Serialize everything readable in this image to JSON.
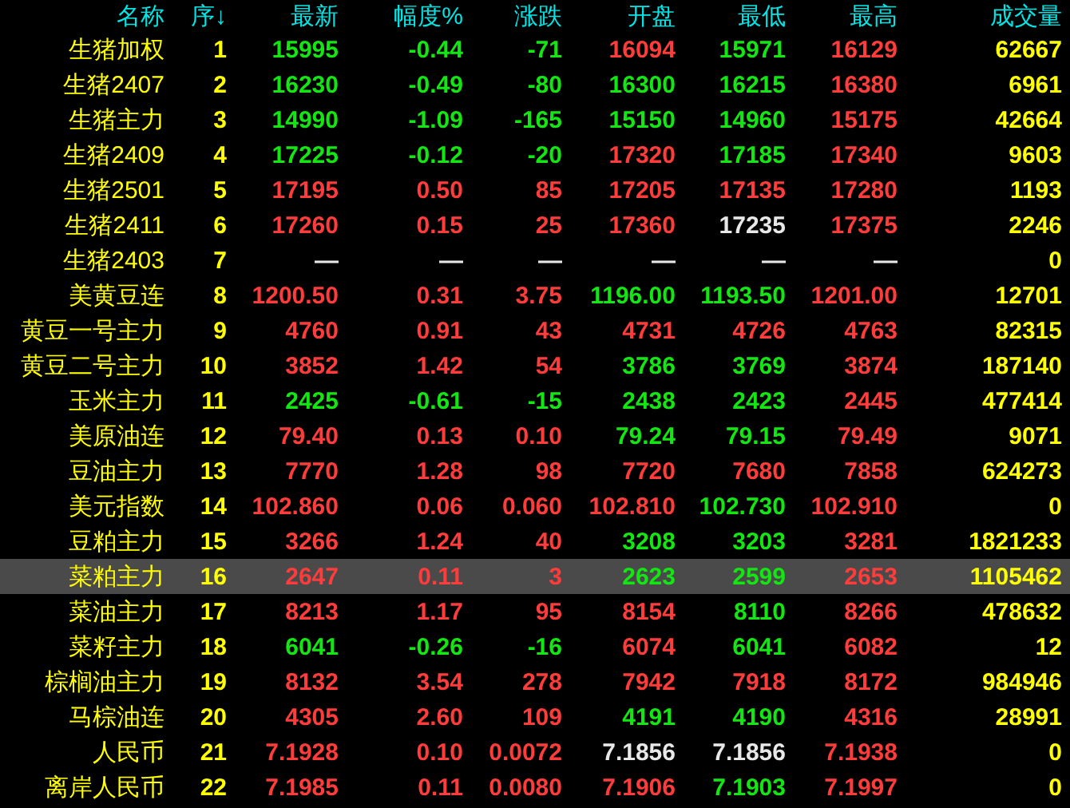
{
  "table": {
    "columns": [
      "名称",
      "序↓",
      "最新",
      "幅度%",
      "涨跌",
      "开盘",
      "最低",
      "最高",
      "成交量"
    ],
    "rows": [
      {
        "selected": false,
        "cells": [
          {
            "text": "生猪加权",
            "color": "#ffff00"
          },
          {
            "text": "1",
            "color": "#ffff00"
          },
          {
            "text": "15995",
            "color": "#14e614"
          },
          {
            "text": "-0.44",
            "color": "#14e614"
          },
          {
            "text": "-71",
            "color": "#14e614"
          },
          {
            "text": "16094",
            "color": "#ff3c3c"
          },
          {
            "text": "15971",
            "color": "#14e614"
          },
          {
            "text": "16129",
            "color": "#ff3c3c"
          },
          {
            "text": "62667",
            "color": "#ffff00"
          }
        ]
      },
      {
        "selected": false,
        "cells": [
          {
            "text": "生猪2407",
            "color": "#ffff00"
          },
          {
            "text": "2",
            "color": "#ffff00"
          },
          {
            "text": "16230",
            "color": "#14e614"
          },
          {
            "text": "-0.49",
            "color": "#14e614"
          },
          {
            "text": "-80",
            "color": "#14e614"
          },
          {
            "text": "16300",
            "color": "#14e614"
          },
          {
            "text": "16215",
            "color": "#14e614"
          },
          {
            "text": "16380",
            "color": "#ff3c3c"
          },
          {
            "text": "6961",
            "color": "#ffff00"
          }
        ]
      },
      {
        "selected": false,
        "cells": [
          {
            "text": "生猪主力",
            "color": "#ffff00"
          },
          {
            "text": "3",
            "color": "#ffff00"
          },
          {
            "text": "14990",
            "color": "#14e614"
          },
          {
            "text": "-1.09",
            "color": "#14e614"
          },
          {
            "text": "-165",
            "color": "#14e614"
          },
          {
            "text": "15150",
            "color": "#14e614"
          },
          {
            "text": "14960",
            "color": "#14e614"
          },
          {
            "text": "15175",
            "color": "#ff3c3c"
          },
          {
            "text": "42664",
            "color": "#ffff00"
          }
        ]
      },
      {
        "selected": false,
        "cells": [
          {
            "text": "生猪2409",
            "color": "#ffff00"
          },
          {
            "text": "4",
            "color": "#ffff00"
          },
          {
            "text": "17225",
            "color": "#14e614"
          },
          {
            "text": "-0.12",
            "color": "#14e614"
          },
          {
            "text": "-20",
            "color": "#14e614"
          },
          {
            "text": "17320",
            "color": "#ff3c3c"
          },
          {
            "text": "17185",
            "color": "#14e614"
          },
          {
            "text": "17340",
            "color": "#ff3c3c"
          },
          {
            "text": "9603",
            "color": "#ffff00"
          }
        ]
      },
      {
        "selected": false,
        "cells": [
          {
            "text": "生猪2501",
            "color": "#ffff00"
          },
          {
            "text": "5",
            "color": "#ffff00"
          },
          {
            "text": "17195",
            "color": "#ff3c3c"
          },
          {
            "text": "0.50",
            "color": "#ff3c3c"
          },
          {
            "text": "85",
            "color": "#ff3c3c"
          },
          {
            "text": "17205",
            "color": "#ff3c3c"
          },
          {
            "text": "17135",
            "color": "#ff3c3c"
          },
          {
            "text": "17280",
            "color": "#ff3c3c"
          },
          {
            "text": "1193",
            "color": "#ffff00"
          }
        ]
      },
      {
        "selected": false,
        "cells": [
          {
            "text": "生猪2411",
            "color": "#ffff00"
          },
          {
            "text": "6",
            "color": "#ffff00"
          },
          {
            "text": "17260",
            "color": "#ff3c3c"
          },
          {
            "text": "0.15",
            "color": "#ff3c3c"
          },
          {
            "text": "25",
            "color": "#ff3c3c"
          },
          {
            "text": "17360",
            "color": "#ff3c3c"
          },
          {
            "text": "17235",
            "color": "#e8e8e8"
          },
          {
            "text": "17375",
            "color": "#ff3c3c"
          },
          {
            "text": "2246",
            "color": "#ffff00"
          }
        ]
      },
      {
        "selected": false,
        "cells": [
          {
            "text": "生猪2403",
            "color": "#ffff00"
          },
          {
            "text": "7",
            "color": "#ffff00"
          },
          {
            "text": "—",
            "color": "#e8e8e8"
          },
          {
            "text": "—",
            "color": "#e8e8e8"
          },
          {
            "text": "—",
            "color": "#e8e8e8"
          },
          {
            "text": "—",
            "color": "#e8e8e8"
          },
          {
            "text": "—",
            "color": "#e8e8e8"
          },
          {
            "text": "—",
            "color": "#e8e8e8"
          },
          {
            "text": "0",
            "color": "#ffff00"
          }
        ]
      },
      {
        "selected": false,
        "cells": [
          {
            "text": "美黄豆连",
            "color": "#ffff00"
          },
          {
            "text": "8",
            "color": "#ffff00"
          },
          {
            "text": "1200.50",
            "color": "#ff3c3c"
          },
          {
            "text": "0.31",
            "color": "#ff3c3c"
          },
          {
            "text": "3.75",
            "color": "#ff3c3c"
          },
          {
            "text": "1196.00",
            "color": "#14e614"
          },
          {
            "text": "1193.50",
            "color": "#14e614"
          },
          {
            "text": "1201.00",
            "color": "#ff3c3c"
          },
          {
            "text": "12701",
            "color": "#ffff00"
          }
        ]
      },
      {
        "selected": false,
        "cells": [
          {
            "text": "黄豆一号主力",
            "color": "#ffff00"
          },
          {
            "text": "9",
            "color": "#ffff00"
          },
          {
            "text": "4760",
            "color": "#ff3c3c"
          },
          {
            "text": "0.91",
            "color": "#ff3c3c"
          },
          {
            "text": "43",
            "color": "#ff3c3c"
          },
          {
            "text": "4731",
            "color": "#ff3c3c"
          },
          {
            "text": "4726",
            "color": "#ff3c3c"
          },
          {
            "text": "4763",
            "color": "#ff3c3c"
          },
          {
            "text": "82315",
            "color": "#ffff00"
          }
        ]
      },
      {
        "selected": false,
        "cells": [
          {
            "text": "黄豆二号主力",
            "color": "#ffff00"
          },
          {
            "text": "10",
            "color": "#ffff00"
          },
          {
            "text": "3852",
            "color": "#ff3c3c"
          },
          {
            "text": "1.42",
            "color": "#ff3c3c"
          },
          {
            "text": "54",
            "color": "#ff3c3c"
          },
          {
            "text": "3786",
            "color": "#14e614"
          },
          {
            "text": "3769",
            "color": "#14e614"
          },
          {
            "text": "3874",
            "color": "#ff3c3c"
          },
          {
            "text": "187140",
            "color": "#ffff00"
          }
        ]
      },
      {
        "selected": false,
        "cells": [
          {
            "text": "玉米主力",
            "color": "#ffff00"
          },
          {
            "text": "11",
            "color": "#ffff00"
          },
          {
            "text": "2425",
            "color": "#14e614"
          },
          {
            "text": "-0.61",
            "color": "#14e614"
          },
          {
            "text": "-15",
            "color": "#14e614"
          },
          {
            "text": "2438",
            "color": "#14e614"
          },
          {
            "text": "2423",
            "color": "#14e614"
          },
          {
            "text": "2445",
            "color": "#ff3c3c"
          },
          {
            "text": "477414",
            "color": "#ffff00"
          }
        ]
      },
      {
        "selected": false,
        "cells": [
          {
            "text": "美原油连",
            "color": "#ffff00"
          },
          {
            "text": "12",
            "color": "#ffff00"
          },
          {
            "text": "79.40",
            "color": "#ff3c3c"
          },
          {
            "text": "0.13",
            "color": "#ff3c3c"
          },
          {
            "text": "0.10",
            "color": "#ff3c3c"
          },
          {
            "text": "79.24",
            "color": "#14e614"
          },
          {
            "text": "79.15",
            "color": "#14e614"
          },
          {
            "text": "79.49",
            "color": "#ff3c3c"
          },
          {
            "text": "9071",
            "color": "#ffff00"
          }
        ]
      },
      {
        "selected": false,
        "cells": [
          {
            "text": "豆油主力",
            "color": "#ffff00"
          },
          {
            "text": "13",
            "color": "#ffff00"
          },
          {
            "text": "7770",
            "color": "#ff3c3c"
          },
          {
            "text": "1.28",
            "color": "#ff3c3c"
          },
          {
            "text": "98",
            "color": "#ff3c3c"
          },
          {
            "text": "7720",
            "color": "#ff3c3c"
          },
          {
            "text": "7680",
            "color": "#ff3c3c"
          },
          {
            "text": "7858",
            "color": "#ff3c3c"
          },
          {
            "text": "624273",
            "color": "#ffff00"
          }
        ]
      },
      {
        "selected": false,
        "cells": [
          {
            "text": "美元指数",
            "color": "#ffff00"
          },
          {
            "text": "14",
            "color": "#ffff00"
          },
          {
            "text": "102.860",
            "color": "#ff3c3c"
          },
          {
            "text": "0.06",
            "color": "#ff3c3c"
          },
          {
            "text": "0.060",
            "color": "#ff3c3c"
          },
          {
            "text": "102.810",
            "color": "#ff3c3c"
          },
          {
            "text": "102.730",
            "color": "#14e614"
          },
          {
            "text": "102.910",
            "color": "#ff3c3c"
          },
          {
            "text": "0",
            "color": "#ffff00"
          }
        ]
      },
      {
        "selected": false,
        "cells": [
          {
            "text": "豆粕主力",
            "color": "#ffff00"
          },
          {
            "text": "15",
            "color": "#ffff00"
          },
          {
            "text": "3266",
            "color": "#ff3c3c"
          },
          {
            "text": "1.24",
            "color": "#ff3c3c"
          },
          {
            "text": "40",
            "color": "#ff3c3c"
          },
          {
            "text": "3208",
            "color": "#14e614"
          },
          {
            "text": "3203",
            "color": "#14e614"
          },
          {
            "text": "3281",
            "color": "#ff3c3c"
          },
          {
            "text": "1821233",
            "color": "#ffff00"
          }
        ]
      },
      {
        "selected": true,
        "cells": [
          {
            "text": "菜粕主力",
            "color": "#ffff00"
          },
          {
            "text": "16",
            "color": "#ffff00"
          },
          {
            "text": "2647",
            "color": "#ff3c3c"
          },
          {
            "text": "0.11",
            "color": "#ff3c3c"
          },
          {
            "text": "3",
            "color": "#ff3c3c"
          },
          {
            "text": "2623",
            "color": "#14e614"
          },
          {
            "text": "2599",
            "color": "#14e614"
          },
          {
            "text": "2653",
            "color": "#ff3c3c"
          },
          {
            "text": "1105462",
            "color": "#ffff00"
          }
        ]
      },
      {
        "selected": false,
        "cells": [
          {
            "text": "菜油主力",
            "color": "#ffff00"
          },
          {
            "text": "17",
            "color": "#ffff00"
          },
          {
            "text": "8213",
            "color": "#ff3c3c"
          },
          {
            "text": "1.17",
            "color": "#ff3c3c"
          },
          {
            "text": "95",
            "color": "#ff3c3c"
          },
          {
            "text": "8154",
            "color": "#ff3c3c"
          },
          {
            "text": "8110",
            "color": "#14e614"
          },
          {
            "text": "8266",
            "color": "#ff3c3c"
          },
          {
            "text": "478632",
            "color": "#ffff00"
          }
        ]
      },
      {
        "selected": false,
        "cells": [
          {
            "text": "菜籽主力",
            "color": "#ffff00"
          },
          {
            "text": "18",
            "color": "#ffff00"
          },
          {
            "text": "6041",
            "color": "#14e614"
          },
          {
            "text": "-0.26",
            "color": "#14e614"
          },
          {
            "text": "-16",
            "color": "#14e614"
          },
          {
            "text": "6074",
            "color": "#ff3c3c"
          },
          {
            "text": "6041",
            "color": "#14e614"
          },
          {
            "text": "6082",
            "color": "#ff3c3c"
          },
          {
            "text": "12",
            "color": "#ffff00"
          }
        ]
      },
      {
        "selected": false,
        "cells": [
          {
            "text": "棕榈油主力",
            "color": "#ffff00"
          },
          {
            "text": "19",
            "color": "#ffff00"
          },
          {
            "text": "8132",
            "color": "#ff3c3c"
          },
          {
            "text": "3.54",
            "color": "#ff3c3c"
          },
          {
            "text": "278",
            "color": "#ff3c3c"
          },
          {
            "text": "7942",
            "color": "#ff3c3c"
          },
          {
            "text": "7918",
            "color": "#ff3c3c"
          },
          {
            "text": "8172",
            "color": "#ff3c3c"
          },
          {
            "text": "984946",
            "color": "#ffff00"
          }
        ]
      },
      {
        "selected": false,
        "cells": [
          {
            "text": "马棕油连",
            "color": "#ffff00"
          },
          {
            "text": "20",
            "color": "#ffff00"
          },
          {
            "text": "4305",
            "color": "#ff3c3c"
          },
          {
            "text": "2.60",
            "color": "#ff3c3c"
          },
          {
            "text": "109",
            "color": "#ff3c3c"
          },
          {
            "text": "4191",
            "color": "#14e614"
          },
          {
            "text": "4190",
            "color": "#14e614"
          },
          {
            "text": "4316",
            "color": "#ff3c3c"
          },
          {
            "text": "28991",
            "color": "#ffff00"
          }
        ]
      },
      {
        "selected": false,
        "cells": [
          {
            "text": "人民币",
            "color": "#ffff00"
          },
          {
            "text": "21",
            "color": "#ffff00"
          },
          {
            "text": "7.1928",
            "color": "#ff3c3c"
          },
          {
            "text": "0.10",
            "color": "#ff3c3c"
          },
          {
            "text": "0.0072",
            "color": "#ff3c3c"
          },
          {
            "text": "7.1856",
            "color": "#e8e8e8"
          },
          {
            "text": "7.1856",
            "color": "#e8e8e8"
          },
          {
            "text": "7.1938",
            "color": "#ff3c3c"
          },
          {
            "text": "0",
            "color": "#ffff00"
          }
        ]
      },
      {
        "selected": false,
        "cells": [
          {
            "text": "离岸人民币",
            "color": "#ffff00"
          },
          {
            "text": "22",
            "color": "#ffff00"
          },
          {
            "text": "7.1985",
            "color": "#ff3c3c"
          },
          {
            "text": "0.11",
            "color": "#ff3c3c"
          },
          {
            "text": "0.0080",
            "color": "#ff3c3c"
          },
          {
            "text": "7.1906",
            "color": "#ff3c3c"
          },
          {
            "text": "7.1903",
            "color": "#14e614"
          },
          {
            "text": "7.1997",
            "color": "#ff3c3c"
          },
          {
            "text": "0",
            "color": "#ffff00"
          }
        ]
      }
    ]
  }
}
